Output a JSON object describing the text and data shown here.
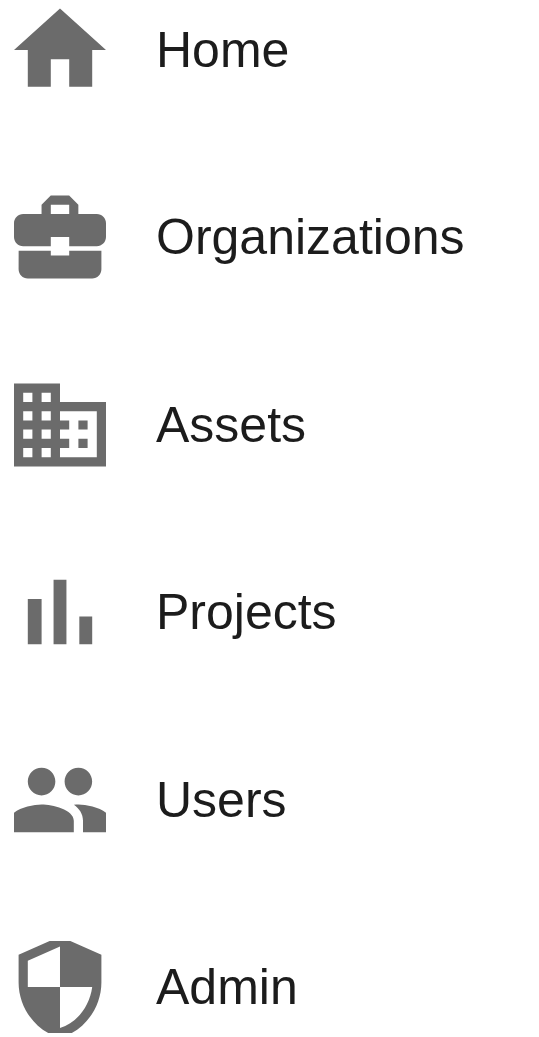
{
  "nav_items": [
    {
      "kind": "home",
      "label": "Home"
    },
    {
      "kind": "organizations",
      "label": "Organizations"
    },
    {
      "kind": "assets",
      "label": "Assets"
    },
    {
      "kind": "projects",
      "label": "Projects"
    },
    {
      "kind": "users",
      "label": "Users"
    },
    {
      "kind": "admin",
      "label": "Admin"
    }
  ]
}
